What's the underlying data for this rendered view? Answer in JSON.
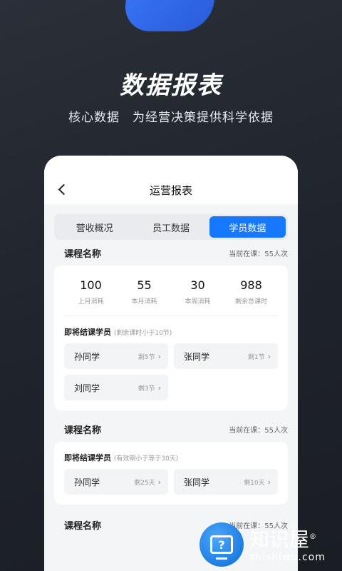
{
  "hero": {
    "title": "数据报表",
    "subtitle": "核心数据　为经营决策提供科学依据"
  },
  "header": {
    "title": "运营报表"
  },
  "tabs": [
    {
      "label": "营收概况",
      "active": false
    },
    {
      "label": "员工数据",
      "active": false
    },
    {
      "label": "学员数据",
      "active": true
    }
  ],
  "section1": {
    "title": "课程名称",
    "meta": "当前在课：55人次",
    "stats": [
      {
        "value": "100",
        "label": "上月消耗"
      },
      {
        "value": "55",
        "label": "本月消耗"
      },
      {
        "value": "30",
        "label": "本周消耗"
      },
      {
        "value": "988",
        "label": "剩余总课时"
      }
    ],
    "sub_title": "即将结课学员",
    "sub_note": "(剩余课时小于10节)",
    "students": [
      {
        "name": "孙同学",
        "remain": "剩5节"
      },
      {
        "name": "张同学",
        "remain": "剩1节"
      },
      {
        "name": "刘同学",
        "remain": "剩3节"
      }
    ]
  },
  "section2": {
    "title": "课程名称",
    "meta": "当前在课：55人次",
    "sub_title": "即将结课学员",
    "sub_note": "(有效期小于等于30天)",
    "students": [
      {
        "name": "孙同学",
        "remain": "剩25天"
      },
      {
        "name": "张同学",
        "remain": "剩10天"
      }
    ]
  },
  "section3": {
    "title": "课程名称",
    "meta": "当前在课：55人次"
  },
  "watermark": {
    "cn": "知识屋",
    "mark": "®",
    "en": "zhishiwu.com",
    "icon_glyph": "?"
  },
  "colors": {
    "accent": "#1677ff",
    "background": "#1f232b"
  }
}
